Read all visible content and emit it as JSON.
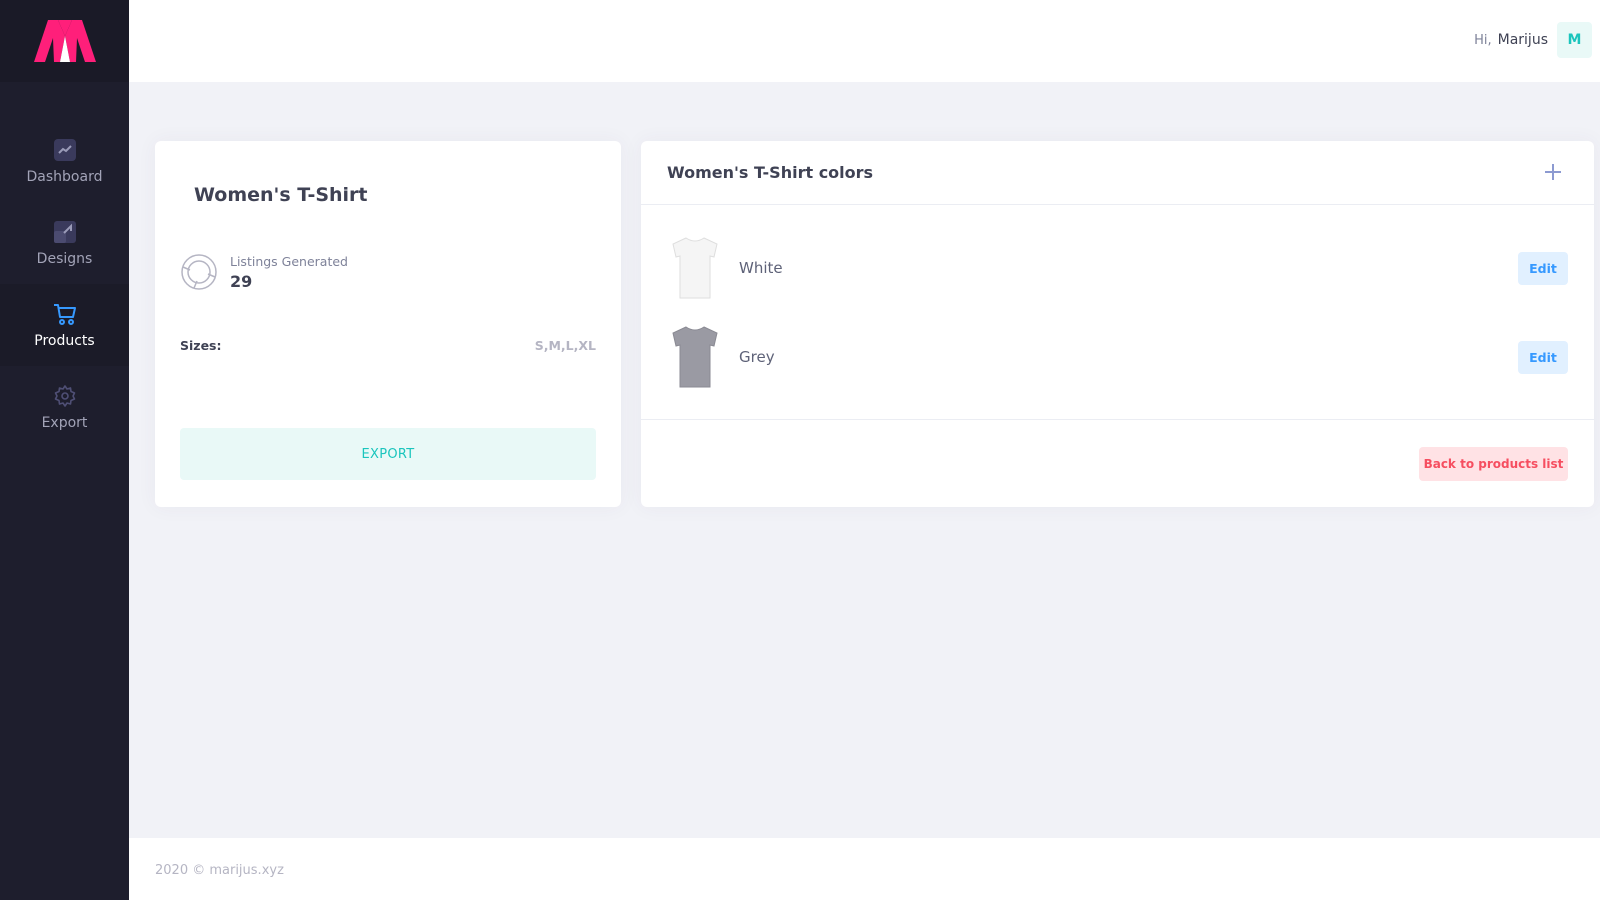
{
  "brand": {
    "logo_icon": "m-logo-icon",
    "colors": [
      "#ff1f7a",
      "#ffffff"
    ]
  },
  "sidebar": {
    "items": [
      {
        "label": "Dashboard",
        "icon": "chart-icon"
      },
      {
        "label": "Designs",
        "icon": "designs-icon"
      },
      {
        "label": "Products",
        "icon": "cart-icon",
        "active": true
      },
      {
        "label": "Export",
        "icon": "gear-icon"
      }
    ]
  },
  "header": {
    "greeting": "Hi,",
    "user_name": "Marijus",
    "avatar_initial": "M"
  },
  "product": {
    "title": "Women's T-Shirt",
    "listings_label": "Listings Generated",
    "listings_value": "29",
    "sizes_label": "Sizes:",
    "sizes_value": "S,M,L,XL",
    "export_label": "EXPORT"
  },
  "colors_card": {
    "title": "Women's T-Shirt colors",
    "add_icon": "plus-icon",
    "rows": [
      {
        "name": "White",
        "edit_label": "Edit",
        "swatch": "#f5f5f5"
      },
      {
        "name": "Grey",
        "edit_label": "Edit",
        "swatch": "#9a9aa3"
      }
    ],
    "back_label": "Back to products list"
  },
  "footer": {
    "text": "2020 © marijus.xyz"
  },
  "theme": {
    "sidebar_bg": "#1e1e2d",
    "accent_teal": "#1bc5bd",
    "accent_blue": "#3699ff",
    "accent_pink": "#f64e60"
  }
}
